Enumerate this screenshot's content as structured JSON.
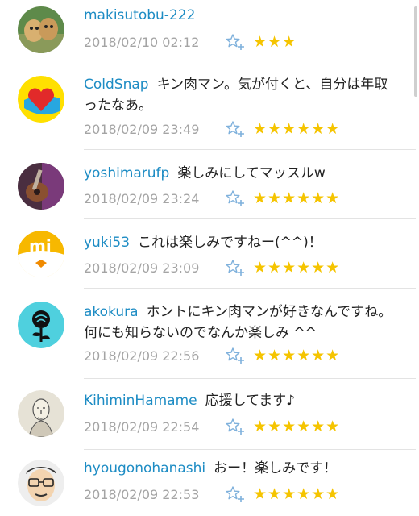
{
  "comments": [
    {
      "user": "makisutobu-222",
      "text": "",
      "date": "2018/02/10 02:12",
      "stars": "★★★",
      "avatar": "dogs-photo"
    },
    {
      "user": "ColdSnap",
      "text": "キン肉マン。気が付くと、自分は年取ったなあ。",
      "date": "2018/02/09 23:49",
      "stars": "★★★★★★",
      "avatar": "heart-ball-logo"
    },
    {
      "user": "yoshimarufp",
      "text": "楽しみにしてマッスルw",
      "date": "2018/02/09 23:24",
      "stars": "★★★★★★",
      "avatar": "guitar-photo"
    },
    {
      "user": "yuki53",
      "text": "これは楽しみですねー(^^)！",
      "date": "2018/02/09 23:09",
      "stars": "★★★★★★",
      "avatar": "mi-chick-logo"
    },
    {
      "user": "akokura",
      "text": "ホントにキン肉マンが好きなんですね。何にも知らないのでなんか楽しみ ^^",
      "date": "2018/02/09 22:56",
      "stars": "★★★★★★",
      "avatar": "rose-icon"
    },
    {
      "user": "KihiminHamame",
      "text": "応援してます♪",
      "date": "2018/02/09 22:54",
      "stars": "★★★★★★",
      "avatar": "portrait-sketch"
    },
    {
      "user": "hyougonohanashi",
      "text": "おー！楽しみです！",
      "date": "2018/02/09 22:53",
      "stars": "★★★★★★",
      "avatar": "glasses-face"
    }
  ],
  "colors": {
    "username": "#1d8cc4",
    "date": "#a4a4a4",
    "star": "#f5c400",
    "favorite_icon": "#7fb1dc"
  },
  "icons": {
    "favorite_add": "star-plus-icon"
  }
}
